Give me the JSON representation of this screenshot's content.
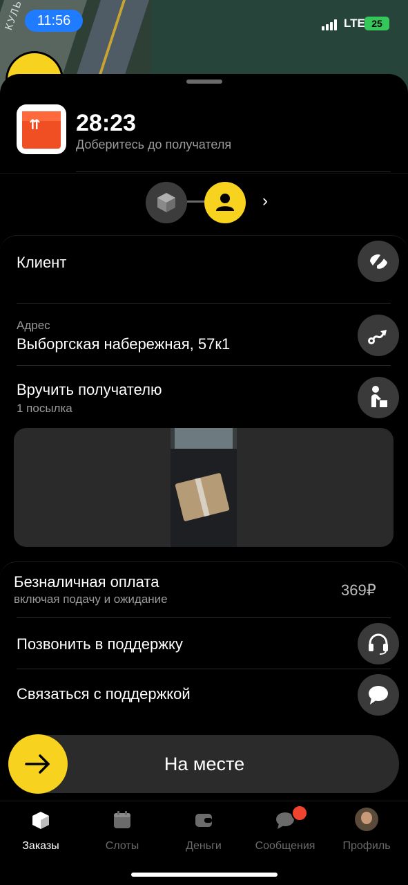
{
  "status_bar": {
    "time": "11:56",
    "network": "LTE",
    "battery": "25"
  },
  "map": {
    "street_label": "КУЛЬТУРЫ"
  },
  "order": {
    "countdown": "28:23",
    "subtitle": "Доберитесь до получателя"
  },
  "details": {
    "client_label": "Клиент",
    "address_caption": "Адрес",
    "address_value": "Выборгская набережная, 57к1",
    "handover_title": "Вручить получателю",
    "handover_sub": "1 посылка"
  },
  "payment": {
    "title": "Безналичная оплата",
    "subtitle": "включая подачу и ожидание",
    "price": "369₽"
  },
  "support": {
    "call_label": "Позвонить в поддержку",
    "chat_label": "Связаться с поддержкой"
  },
  "action": {
    "label": "На месте"
  },
  "tabs": [
    {
      "label": "Заказы",
      "icon": "orders-icon",
      "active": true
    },
    {
      "label": "Слоты",
      "icon": "calendar-icon",
      "active": false
    },
    {
      "label": "Деньги",
      "icon": "wallet-icon",
      "active": false
    },
    {
      "label": "Сообщения",
      "icon": "chat-icon",
      "active": false
    },
    {
      "label": "Профиль",
      "icon": "avatar",
      "active": false
    }
  ],
  "colors": {
    "accent_yellow": "#f7d21e",
    "time_pill_blue": "#1f7bff",
    "notification_red": "#f0442f",
    "battery_green": "#35c759"
  }
}
